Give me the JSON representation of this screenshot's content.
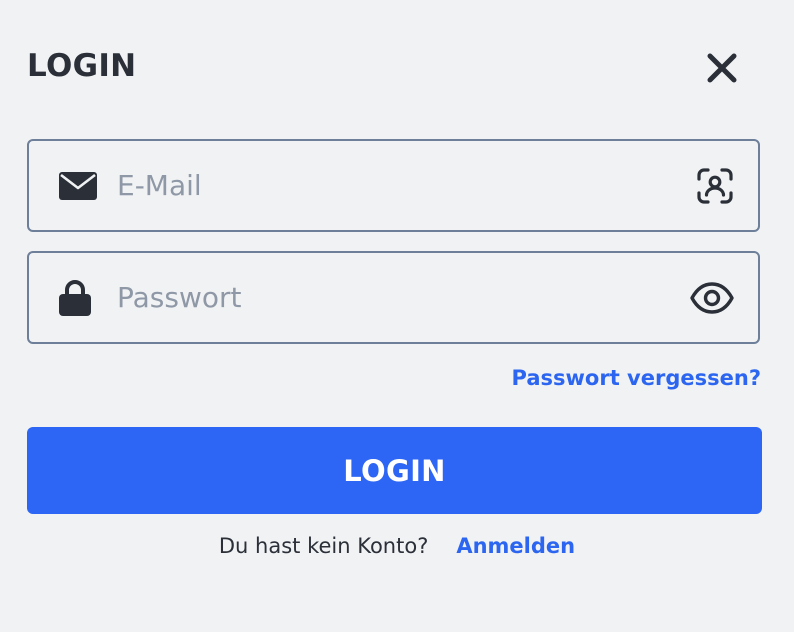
{
  "dialog": {
    "title": "LOGIN",
    "close_icon": "close-icon"
  },
  "email_field": {
    "placeholder": "E-Mail",
    "value": "",
    "leading_icon": "envelope-icon",
    "trailing_icon": "face-id-icon"
  },
  "password_field": {
    "placeholder": "Passwort",
    "value": "",
    "leading_icon": "lock-icon",
    "trailing_icon": "eye-icon"
  },
  "forgot_password_label": "Passwort vergessen?",
  "login_button_label": "LOGIN",
  "signup": {
    "question": "Du hast kein Konto?",
    "link_label": "Anmelden"
  },
  "colors": {
    "background": "#f1f2f4",
    "accent": "#2d66f4",
    "text": "#2a2f38",
    "placeholder": "#8f98a6",
    "border": "#6e7f99"
  }
}
